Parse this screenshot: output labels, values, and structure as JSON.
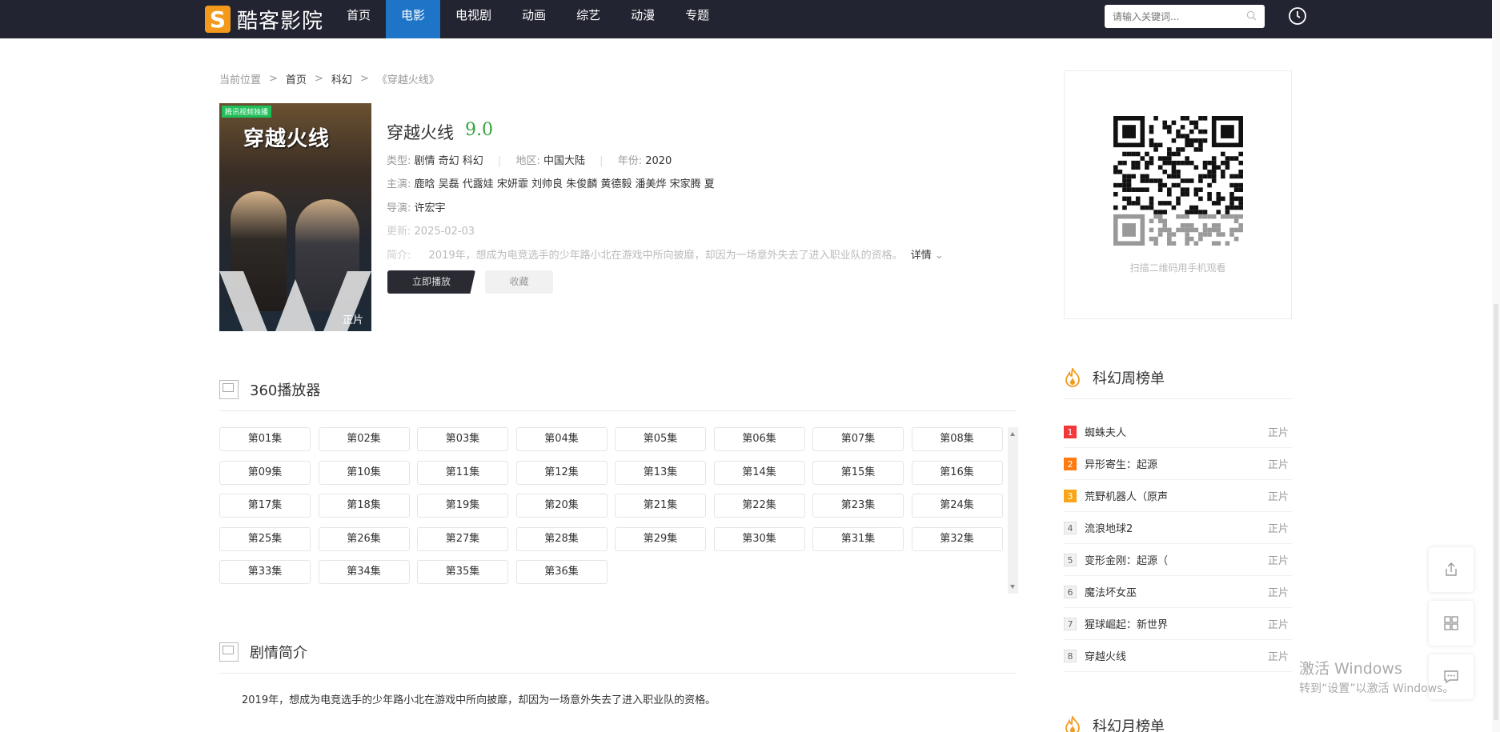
{
  "header": {
    "site_name": "酷客影院",
    "nav": [
      "首页",
      "电影",
      "电视剧",
      "动画",
      "综艺",
      "动漫",
      "专题"
    ],
    "active_nav": "电影",
    "search_placeholder": "请输入关键词..."
  },
  "breadcrumb": {
    "label": "当前位置",
    "items": [
      "首页",
      "科幻",
      "《穿越火线》"
    ]
  },
  "poster": {
    "badge": "腾讯视频独播",
    "title": "穿越火线",
    "tag": "正片"
  },
  "movie": {
    "title": "穿越火线",
    "score": "9.0",
    "type_label": "类型:",
    "type_value": "剧情 奇幻 科幻",
    "region_label": "地区:",
    "region_value": "中国大陆",
    "year_label": "年份:",
    "year_value": "2020",
    "cast_label": "主演:",
    "cast_value": "鹿晗 吴磊 代露娃 宋妍霏 刘帅良 朱俊麟 黄德毅 潘美烨 宋家腾 夏",
    "director_label": "导演:",
    "director_value": "许宏宇",
    "update_label": "更新:",
    "update_value": "2025-02-03",
    "intro_label": "简介:",
    "intro_value": "2019年，想成为电竞选手的少年路小北在游戏中所向披靡，却因为一场意外失去了进入职业队的资格。",
    "detail_link": "详情",
    "play_button": "立即播放",
    "fav_button": "收藏"
  },
  "player": {
    "title": "360播放器",
    "episodes": [
      "第01集",
      "第02集",
      "第03集",
      "第04集",
      "第05集",
      "第06集",
      "第07集",
      "第08集",
      "第09集",
      "第10集",
      "第11集",
      "第12集",
      "第13集",
      "第14集",
      "第15集",
      "第16集",
      "第17集",
      "第18集",
      "第19集",
      "第20集",
      "第21集",
      "第22集",
      "第23集",
      "第24集",
      "第25集",
      "第26集",
      "第27集",
      "第28集",
      "第29集",
      "第30集",
      "第31集",
      "第32集",
      "第33集",
      "第34集",
      "第35集",
      "第36集"
    ]
  },
  "plot": {
    "title": "剧情简介",
    "text": "2019年，想成为电竞选手的少年路小北在游戏中所向披靡，却因为一场意外失去了进入职业队的资格。"
  },
  "qr": {
    "caption": "扫描二维码用手机观看"
  },
  "weekly_rank": {
    "title": "科幻周榜单",
    "items": [
      {
        "rank": "1",
        "name": "蜘蛛夫人",
        "tag": "正片"
      },
      {
        "rank": "2",
        "name": "异形寄生：起源",
        "tag": "正片"
      },
      {
        "rank": "3",
        "name": "荒野机器人（原声",
        "tag": "正片"
      },
      {
        "rank": "4",
        "name": "流浪地球2",
        "tag": "正片"
      },
      {
        "rank": "5",
        "name": "变形金刚：起源（",
        "tag": "正片"
      },
      {
        "rank": "6",
        "name": "魔法坏女巫",
        "tag": "正片"
      },
      {
        "rank": "7",
        "name": "猩球崛起：新世界",
        "tag": "正片"
      },
      {
        "rank": "8",
        "name": "穿越火线",
        "tag": "正片"
      }
    ]
  },
  "monthly_rank": {
    "title": "科幻月榜单"
  },
  "watermark": {
    "line1": "激活 Windows",
    "line2": "转到“设置”以激活 Windows。"
  },
  "colors": {
    "header_bg": "#222431",
    "nav_active": "#1e74c6",
    "score": "#37a33f"
  }
}
